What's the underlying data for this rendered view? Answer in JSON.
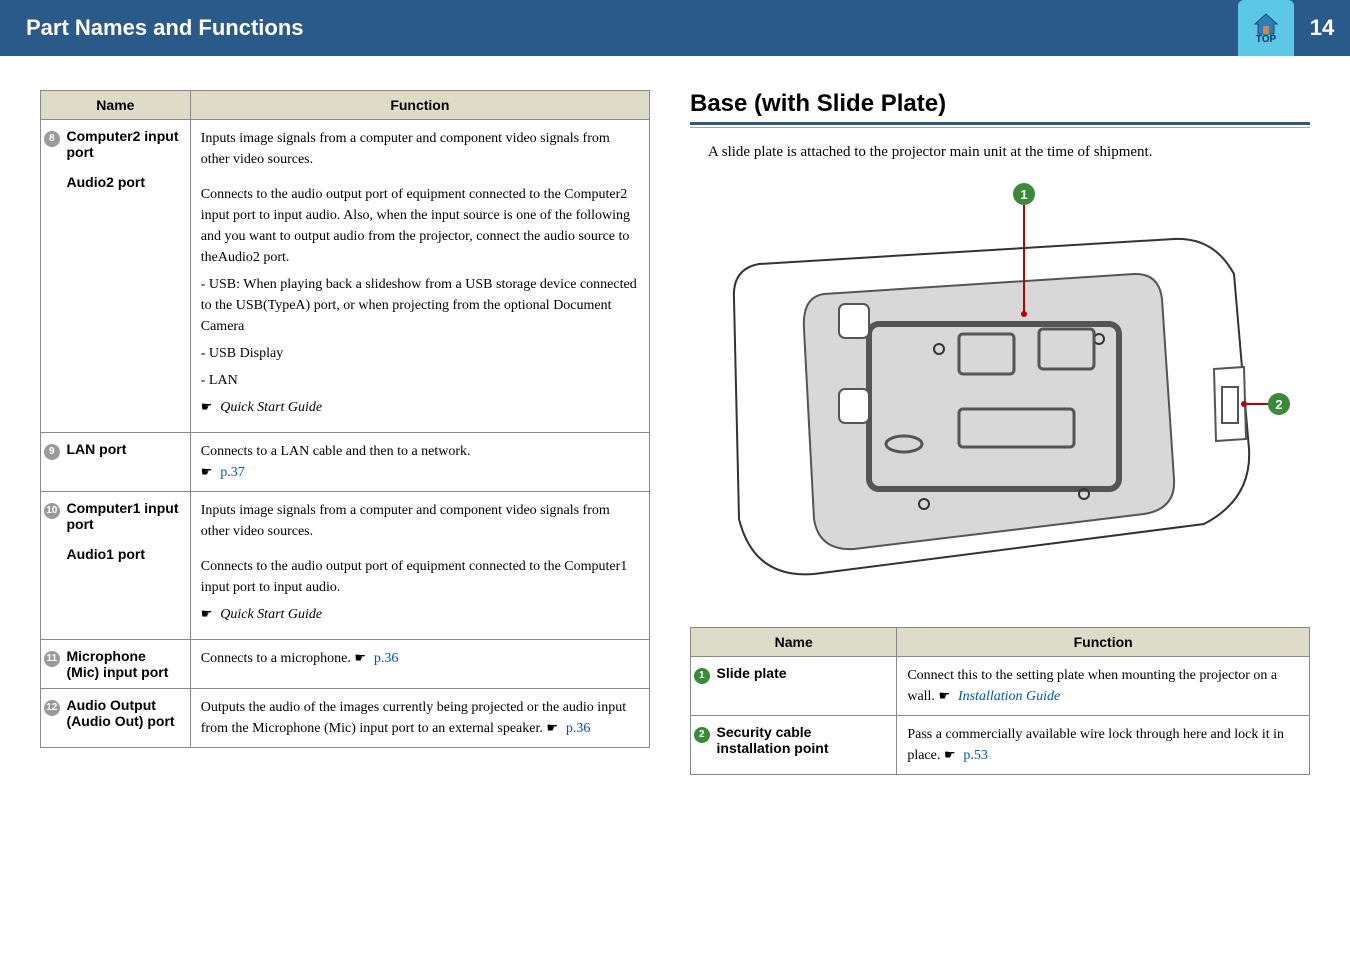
{
  "header": {
    "title": "Part Names and Functions",
    "top": "TOP",
    "page": "14"
  },
  "left_table": {
    "headers": {
      "name": "Name",
      "function": "Function"
    },
    "rows": [
      {
        "num": "8",
        "badge": "grey",
        "name1": "Computer2 input port",
        "name2": "Audio2 port",
        "func_p1": "Inputs image signals from a computer and component video signals from other video sources.",
        "func_p2": "Connects to the audio output port of equipment connected to the Computer2 input port to input audio. Also, when the input source is one of the following and you want to output audio from the projector, connect the audio source to theAudio2 port.",
        "func_p3": "- USB: When playing back a slideshow from a USB storage device connected to the USB(TypeA) port, or when projecting from the optional Document Camera",
        "func_p4": "- USB Display",
        "func_p5": "- LAN",
        "func_p6": "Quick Start Guide"
      },
      {
        "num": "9",
        "badge": "grey",
        "name1": "LAN port",
        "func_p1": "Connects to a LAN cable and then to a network.",
        "link": "p.37"
      },
      {
        "num": "10",
        "badge": "grey",
        "name1": "Computer1 input port",
        "name2": "Audio1 port",
        "func_p1": "Inputs image signals from a computer and component video signals from other video sources.",
        "func_p2": "Connects to the audio output port of equipment connected to the Computer1 input port to input audio.",
        "func_p3": "Quick Start Guide"
      },
      {
        "num": "11",
        "badge": "grey",
        "name1": "Microphone (Mic) input port",
        "func_p1_pre": "Connects to a microphone. ",
        "link": "p.36"
      },
      {
        "num": "12",
        "badge": "grey",
        "name1": "Audio Output (Audio Out) port",
        "func_p1": "Outputs the audio of the images currently being projected or the audio input from the Microphone (Mic) input port to an external speaker. ",
        "link": "p.36"
      }
    ]
  },
  "right": {
    "title": "Base (with Slide Plate)",
    "intro": "A slide plate is attached to the projector main unit at the time of shipment.",
    "table": {
      "headers": {
        "name": "Name",
        "function": "Function"
      },
      "rows": [
        {
          "num": "1",
          "badge": "green",
          "name": "Slide plate",
          "func": "Connect this to the setting plate when mounting the projector on a wall. ",
          "link": "Installation Guide"
        },
        {
          "num": "2",
          "badge": "green",
          "name": "Security cable installation point",
          "func": "Pass a commercially available wire lock through here and lock it in place. ",
          "link": "p.53"
        }
      ]
    }
  }
}
